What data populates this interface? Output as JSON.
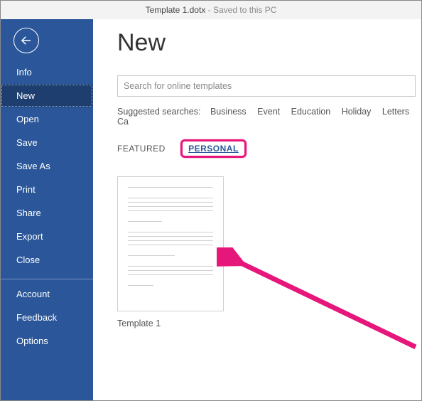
{
  "header": {
    "filename": "Template 1.dotx",
    "subtitle": "Saved to this PC"
  },
  "sidebar": {
    "items": [
      {
        "label": "Info"
      },
      {
        "label": "New"
      },
      {
        "label": "Open"
      },
      {
        "label": "Save"
      },
      {
        "label": "Save As"
      },
      {
        "label": "Print"
      },
      {
        "label": "Share"
      },
      {
        "label": "Export"
      },
      {
        "label": "Close"
      }
    ],
    "footer": [
      {
        "label": "Account"
      },
      {
        "label": "Feedback"
      },
      {
        "label": "Options"
      }
    ],
    "active_index": 1
  },
  "main": {
    "title": "New",
    "search_placeholder": "Search for online templates",
    "suggested_label": "Suggested searches:",
    "suggested": [
      "Business",
      "Event",
      "Education",
      "Holiday",
      "Letters",
      "Ca"
    ],
    "tabs": [
      {
        "label": "FEATURED"
      },
      {
        "label": "PERSONAL"
      }
    ],
    "active_tab": 1,
    "templates": [
      {
        "name": "Template 1"
      }
    ]
  },
  "annotation": {
    "highlight_target": "tab-personal",
    "arrow_color": "#e6177b"
  }
}
